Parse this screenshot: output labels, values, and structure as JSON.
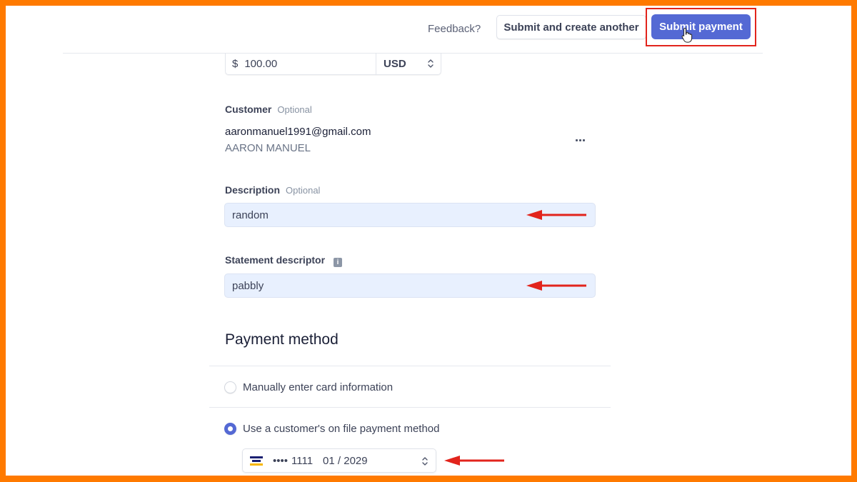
{
  "header": {
    "feedback_label": "Feedback?",
    "submit_create_another_label": "Submit and create another",
    "submit_payment_label": "Submit payment"
  },
  "amount": {
    "currency_symbol": "$",
    "value": "100.00",
    "currency": "USD"
  },
  "customer": {
    "label": "Customer",
    "optional": "Optional",
    "email": "aaronmanuel1991@gmail.com",
    "name": "AARON MANUEL",
    "more_icon": "ellipsis-icon"
  },
  "description": {
    "label": "Description",
    "optional": "Optional",
    "value": "random"
  },
  "statement_descriptor": {
    "label": "Statement descriptor",
    "info_icon": "info-icon",
    "info_glyph": "i",
    "value": "pabbly"
  },
  "payment_method": {
    "title": "Payment method",
    "options": [
      {
        "label": "Manually enter card information",
        "selected": false
      },
      {
        "label": "Use a customer's on file payment method",
        "selected": true
      }
    ],
    "card": {
      "brand_icon": "card-brand-icon",
      "masked": "••••",
      "last4": "1111",
      "expiry": "01 / 2029"
    }
  },
  "annotations": {
    "arrow_color": "#e2241c",
    "highlight_color": "#e2241c",
    "frame_color": "#ff7a00"
  },
  "colors": {
    "primary": "#5469d4",
    "autofill_bg": "#e8f0fe"
  }
}
